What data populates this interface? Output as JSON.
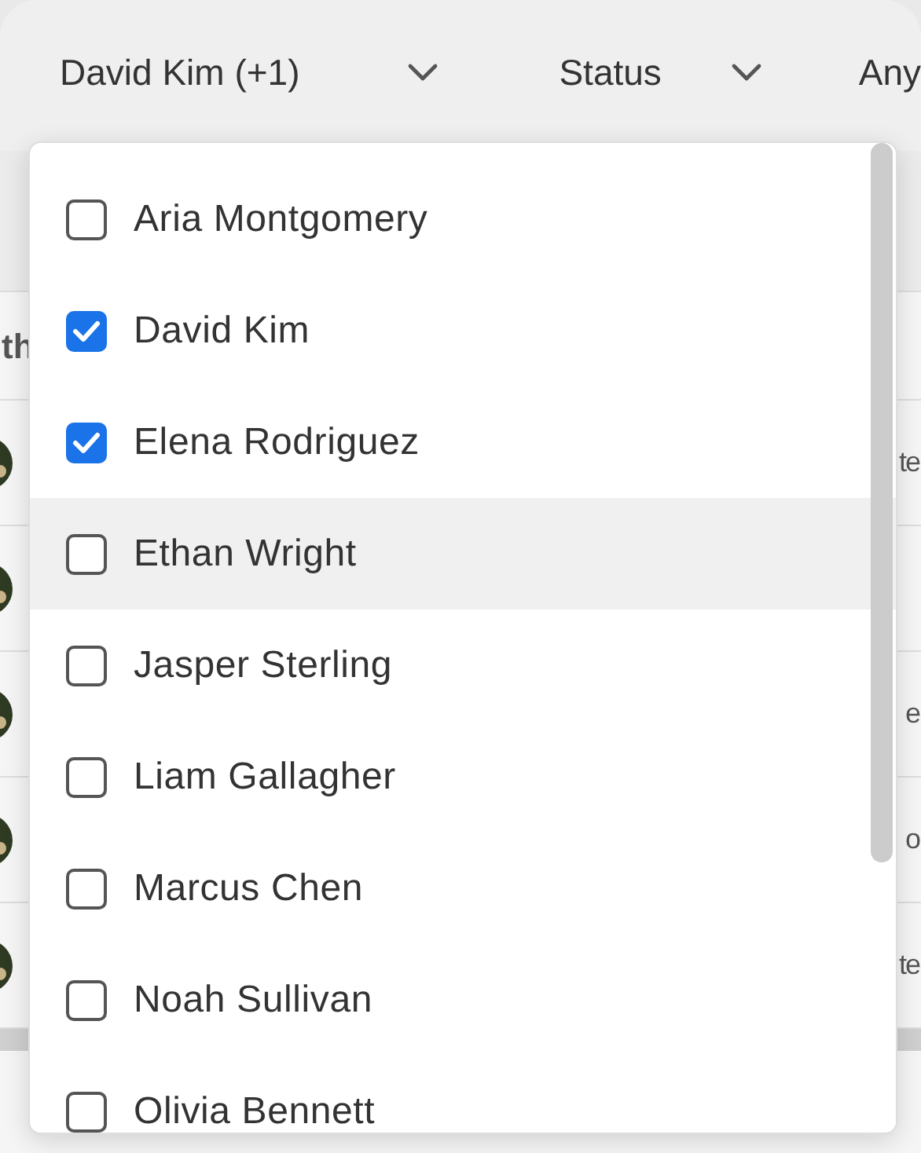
{
  "filters": [
    {
      "label": "David Kim (+1)",
      "chevron": true
    },
    {
      "label": "Status",
      "chevron": true
    },
    {
      "label": "Any",
      "chevron": false
    }
  ],
  "table": {
    "header": {
      "column_1": "th"
    },
    "rows": [
      {
        "column_last": "te"
      },
      {
        "column_last": ""
      },
      {
        "column_last": "e"
      },
      {
        "column_last": "o"
      },
      {
        "column_last": "te"
      }
    ]
  },
  "dropdown": {
    "options": [
      {
        "label": "Aria Montgomery",
        "checked": false,
        "highlighted": false
      },
      {
        "label": "David Kim",
        "checked": true,
        "highlighted": false
      },
      {
        "label": "Elena Rodriguez",
        "checked": true,
        "highlighted": false
      },
      {
        "label": "Ethan Wright",
        "checked": false,
        "highlighted": true
      },
      {
        "label": "Jasper Sterling",
        "checked": false,
        "highlighted": false
      },
      {
        "label": "Liam Gallagher",
        "checked": false,
        "highlighted": false
      },
      {
        "label": "Marcus Chen",
        "checked": false,
        "highlighted": false
      },
      {
        "label": "Noah Sullivan",
        "checked": false,
        "highlighted": false
      },
      {
        "label": "Olivia Bennett",
        "checked": false,
        "highlighted": false
      }
    ]
  }
}
